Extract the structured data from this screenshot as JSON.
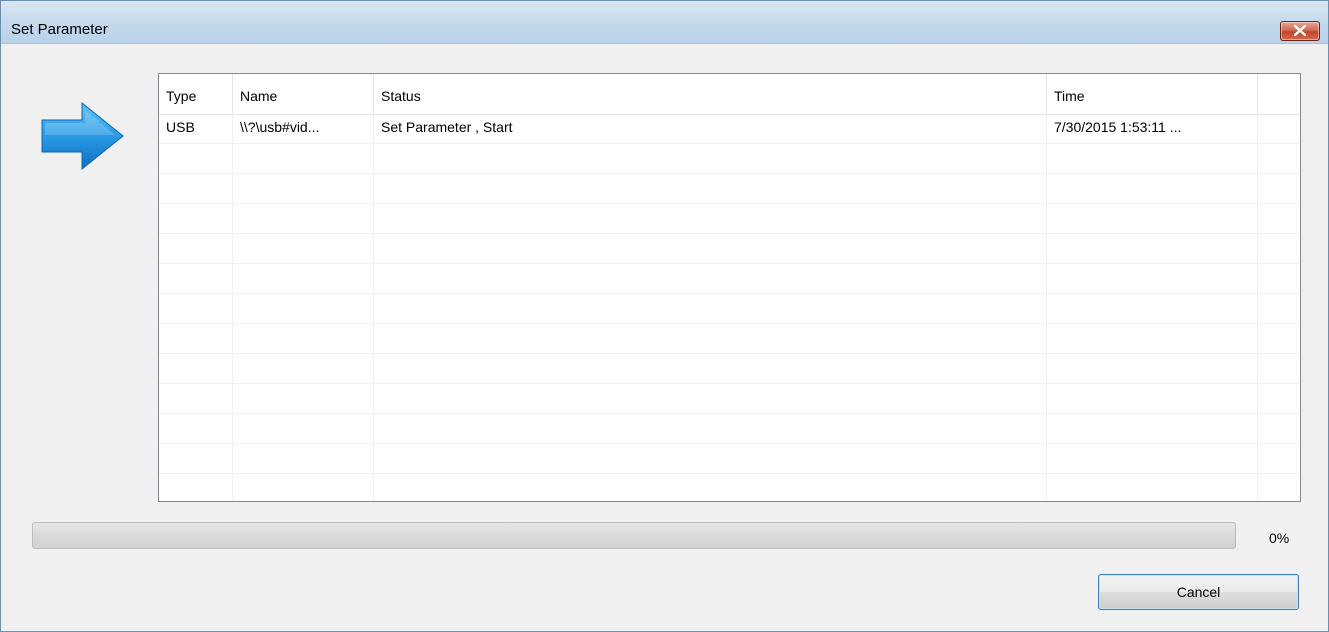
{
  "window": {
    "title": "Set Parameter"
  },
  "colors": {
    "arrow": "#1e8fe0",
    "close_button": "#c7472c",
    "button_border": "#3c7fb1"
  },
  "icons": {
    "arrow": "arrow-right-icon",
    "close": "close-icon"
  },
  "table": {
    "columns": [
      "Type",
      "Name",
      "Status",
      "Time"
    ],
    "rows": [
      {
        "type": "USB",
        "name": "\\\\?\\usb#vid...",
        "status": "Set Parameter , Start",
        "time": "7/30/2015 1:53:11 ..."
      }
    ]
  },
  "progress": {
    "percent_label": "0%",
    "value": 0
  },
  "buttons": {
    "cancel": "Cancel"
  }
}
